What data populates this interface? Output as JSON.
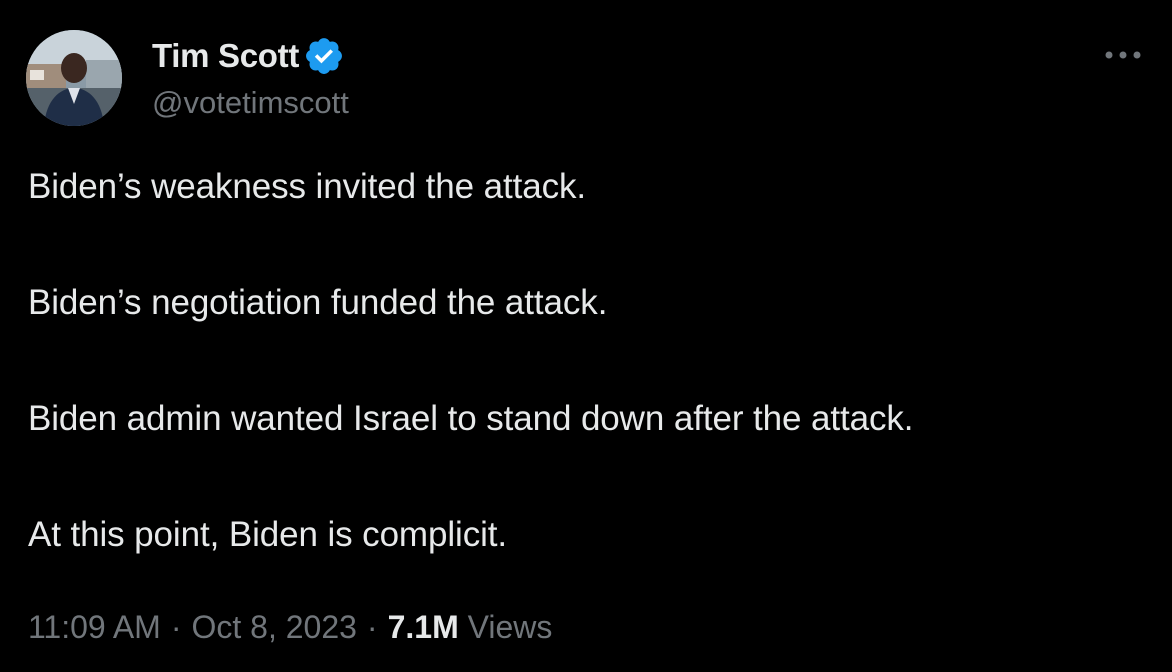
{
  "author": {
    "display_name": "Tim Scott",
    "handle": "@votetimscott",
    "verified": true,
    "verified_color": "#1d9bf0",
    "avatar_icon": "profile-photo"
  },
  "tweet": {
    "lines": [
      "Biden’s weakness invited the attack.",
      "Biden’s negotiation funded the attack.",
      "Biden admin wanted Israel to stand down after the attack.",
      "At this point, Biden is complicit."
    ],
    "time": "11:09 AM",
    "separator": "·",
    "date": "Oct 8, 2023",
    "views_count": "7.1M",
    "views_label": "Views"
  },
  "menu": {
    "icon": "more-horizontal-icon"
  },
  "colors": {
    "background": "#000000",
    "primary_text": "#e7e9ea",
    "secondary_text": "#71767b",
    "accent": "#1d9bf0"
  }
}
